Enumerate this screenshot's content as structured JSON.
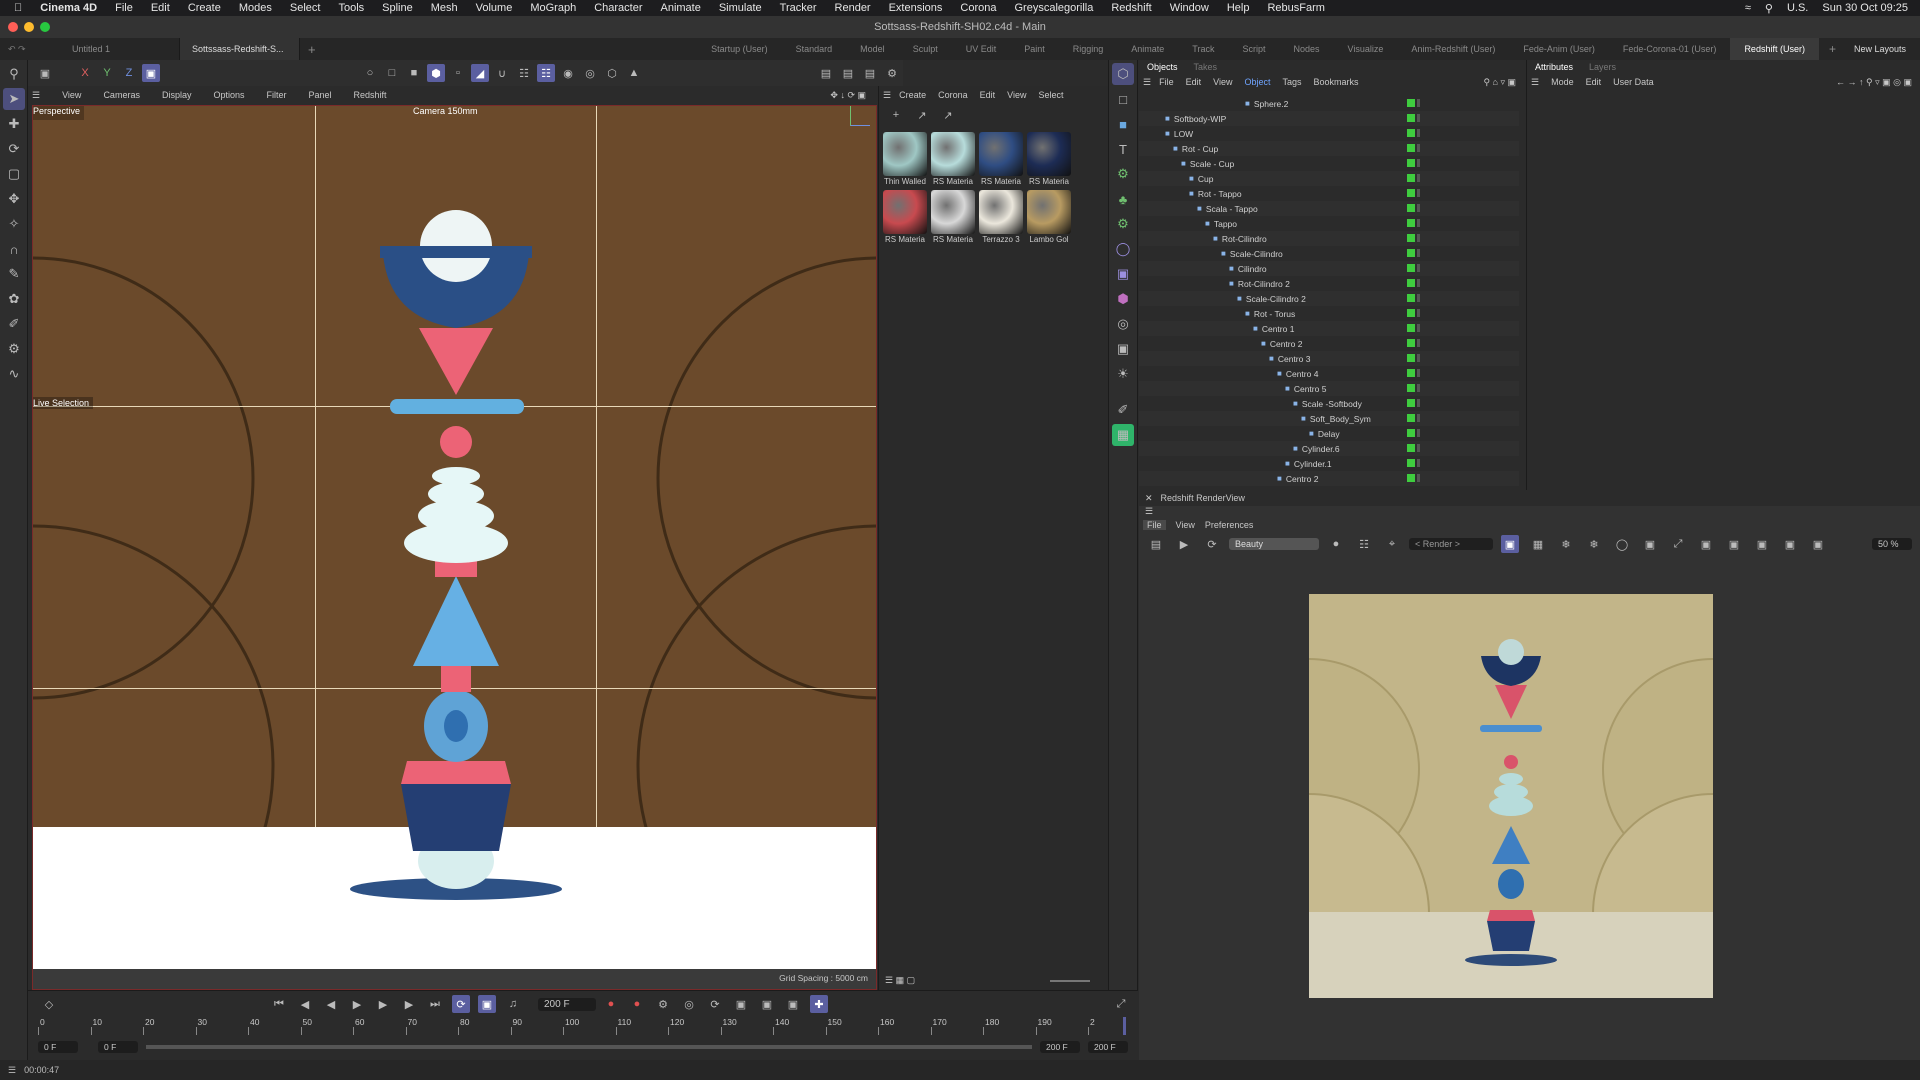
{
  "menubar": {
    "app": "Cinema 4D",
    "items": [
      "File",
      "Edit",
      "Create",
      "Modes",
      "Select",
      "Tools",
      "Spline",
      "Mesh",
      "Volume",
      "MoGraph",
      "Character",
      "Animate",
      "Simulate",
      "Tracker",
      "Render",
      "Extensions",
      "Corona",
      "Greyscalegorilla",
      "Redshift",
      "Window",
      "Help",
      "RebusFarm"
    ],
    "input_source": "U.S.",
    "datetime": "Sun 30 Oct  09:25"
  },
  "window": {
    "title": "Sottsass-Redshift-SH02.c4d - Main"
  },
  "doc_tabs": [
    "Untitled 1",
    "Sottssass-Redshift-S..."
  ],
  "layout_tabs": [
    "Startup (User)",
    "Standard",
    "Model",
    "Sculpt",
    "UV Edit",
    "Paint",
    "Rigging",
    "Animate",
    "Track",
    "Script",
    "Nodes",
    "Visualize",
    "Anim-Redshift (User)",
    "Fede-Anim (User)",
    "Fede-Corona-01 (User)",
    "Redshift (User)"
  ],
  "new_layouts": "New Layouts",
  "coord_axes": [
    "X",
    "Y",
    "Z"
  ],
  "viewport": {
    "menu": [
      "View",
      "Cameras",
      "Display",
      "Options",
      "Filter",
      "Panel",
      "Redshift"
    ],
    "projection": "Perspective",
    "camera": "Camera 150mm",
    "tool_label": "Live Selection",
    "grid_spacing": "Grid Spacing : 5000 cm"
  },
  "materials": {
    "menu": [
      "Create",
      "Corona",
      "Edit",
      "View",
      "Select"
    ],
    "items": [
      {
        "label": "Thin Walled",
        "color": "#9fc7c4"
      },
      {
        "label": "RS Materia",
        "color": "#b7dcdb"
      },
      {
        "label": "RS Materia",
        "color": "#2f4d83"
      },
      {
        "label": "RS Materia",
        "color": "#1d2c55"
      },
      {
        "label": "RS Materia",
        "color": "#c84a4f"
      },
      {
        "label": "RS Materia",
        "color": "#d8d8d8"
      },
      {
        "label": "Terrazzo 3",
        "color": "#ebe7dc"
      },
      {
        "label": "Lambo Gol",
        "color": "#b89b62"
      }
    ]
  },
  "objects": {
    "tabs": [
      "Objects",
      "Takes"
    ],
    "menu": [
      "File",
      "Edit",
      "View",
      "Object",
      "Tags",
      "Bookmarks"
    ],
    "rows": [
      {
        "name": "Sphere.2",
        "indent": 12
      },
      {
        "name": "Softbody-WIP",
        "indent": 2
      },
      {
        "name": "LOW",
        "indent": 2
      },
      {
        "name": "Rot - Cup",
        "indent": 3
      },
      {
        "name": "Scale - Cup",
        "indent": 4
      },
      {
        "name": "Cup",
        "indent": 5
      },
      {
        "name": "Rot - Tappo",
        "indent": 5
      },
      {
        "name": "Scala - Tappo",
        "indent": 6
      },
      {
        "name": "Tappo",
        "indent": 7
      },
      {
        "name": "Rot-Cilindro",
        "indent": 8
      },
      {
        "name": "Scale-Cilindro",
        "indent": 9
      },
      {
        "name": "Cilindro",
        "indent": 10
      },
      {
        "name": "Rot-Cilindro 2",
        "indent": 10
      },
      {
        "name": "Scale-Cilindro 2",
        "indent": 11
      },
      {
        "name": "Rot - Torus",
        "indent": 12
      },
      {
        "name": "Centro 1",
        "indent": 13
      },
      {
        "name": "Centro 2",
        "indent": 14
      },
      {
        "name": "Centro 3",
        "indent": 15
      },
      {
        "name": "Centro 4",
        "indent": 16
      },
      {
        "name": "Centro 5",
        "indent": 17
      },
      {
        "name": "Scale -Softbody",
        "indent": 18
      },
      {
        "name": "Soft_Body_Sym",
        "indent": 19
      },
      {
        "name": "Delay",
        "indent": 20
      },
      {
        "name": "Cylinder.6",
        "indent": 18
      },
      {
        "name": "Cylinder.1",
        "indent": 17
      },
      {
        "name": "Centro 2",
        "indent": 16
      }
    ]
  },
  "attributes": {
    "tabs": [
      "Attributes",
      "Layers"
    ],
    "menu": [
      "Mode",
      "Edit",
      "User Data"
    ]
  },
  "renderview": {
    "title": "Redshift RenderView",
    "menu": [
      "File",
      "View",
      "Preferences"
    ],
    "aov": "Beauty",
    "render_select": "< Render >",
    "zoom": "50 %"
  },
  "timeline": {
    "current_frame": "200 F",
    "ticks": [
      "0",
      "10",
      "20",
      "30",
      "40",
      "50",
      "60",
      "70",
      "80",
      "90",
      "100",
      "110",
      "120",
      "130",
      "140",
      "150",
      "160",
      "170",
      "180",
      "190",
      "2"
    ],
    "start_a": "0 F",
    "start_b": "0 F",
    "end_a": "200 F",
    "end_b": "200 F"
  },
  "status": {
    "time": "00:00:47"
  }
}
